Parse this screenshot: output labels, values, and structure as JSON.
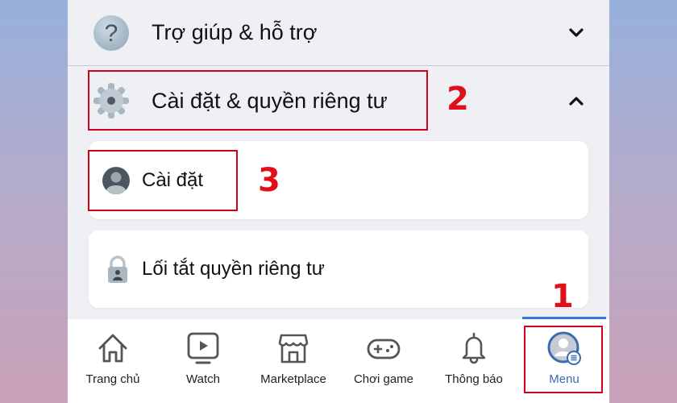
{
  "menu": {
    "help_section": {
      "label": "Trợ giúp & hỗ trợ",
      "icon": "question-icon",
      "state": "collapsed"
    },
    "settings_section": {
      "label": "Cài đặt & quyền riêng tư",
      "icon": "gear-icon",
      "state": "expanded"
    },
    "settings_items": [
      {
        "label": "Cài đặt",
        "icon": "user-circle-icon"
      },
      {
        "label": "Lối tắt quyền riêng tư",
        "icon": "lock-icon"
      }
    ]
  },
  "annotations": {
    "step1": "1",
    "step2": "2",
    "step3": "3",
    "color": "#d0021b"
  },
  "tabbar": {
    "items": [
      {
        "label": "Trang chủ",
        "icon": "home-icon"
      },
      {
        "label": "Watch",
        "icon": "watch-icon"
      },
      {
        "label": "Marketplace",
        "icon": "marketplace-icon"
      },
      {
        "label": "Chơi game",
        "icon": "gamepad-icon"
      },
      {
        "label": "Thông báo",
        "icon": "bell-icon"
      },
      {
        "label": "Menu",
        "icon": "menu-avatar-icon",
        "active": true
      }
    ],
    "active_color": "#3b78d8"
  }
}
